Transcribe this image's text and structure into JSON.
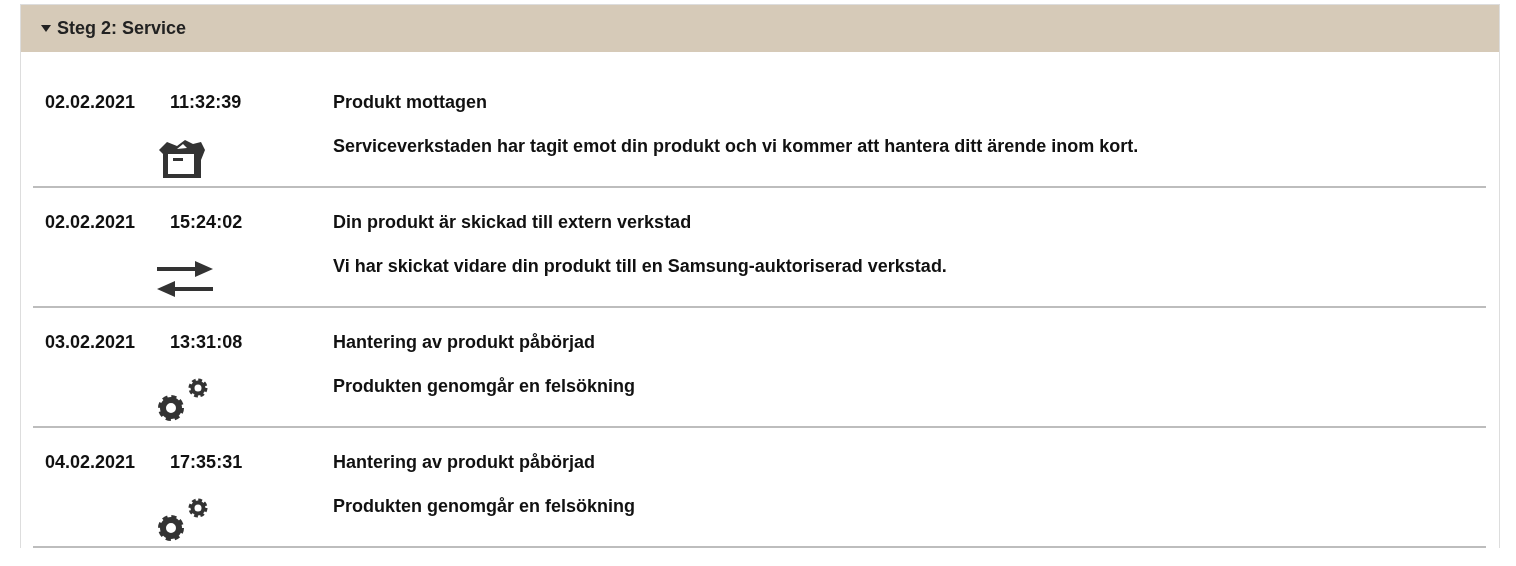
{
  "section": {
    "title": "Steg 2: Service",
    "expanded": true
  },
  "events": [
    {
      "date": "02.02.2021",
      "time": "11:32:39",
      "title": "Produkt mottagen",
      "description": "Serviceverkstaden har tagit emot din produkt och vi kommer att hantera ditt ärende inom kort.",
      "kind": "box"
    },
    {
      "date": "02.02.2021",
      "time": "15:24:02",
      "title": "Din produkt är skickad till extern verkstad",
      "description": "Vi har skickat vidare din produkt till en Samsung-auktoriserad verkstad.",
      "kind": "transfer"
    },
    {
      "date": "03.02.2021",
      "time": "13:31:08",
      "title": "Hantering av produkt påbörjad",
      "description": "Produkten genomgår en felsökning",
      "kind": "gears"
    },
    {
      "date": "04.02.2021",
      "time": "17:35:31",
      "title": "Hantering av produkt påbörjad",
      "description": "Produkten genomgår en felsökning",
      "kind": "gears"
    }
  ]
}
